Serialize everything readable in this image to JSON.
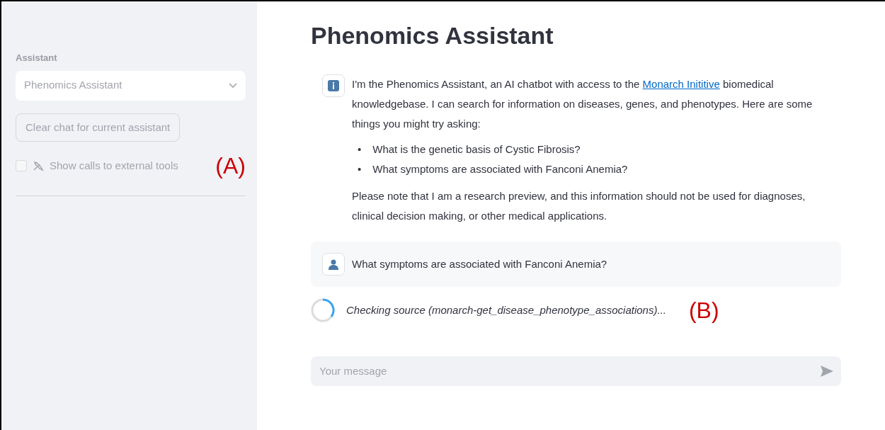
{
  "sidebar": {
    "select_label": "Assistant",
    "select": {
      "value": "Phenomics Assistant",
      "disabled": true
    },
    "clear_button": {
      "label": "Clear chat for current assistant",
      "disabled": true
    },
    "checkbox": {
      "label": "Show calls to external tools",
      "checked": false,
      "disabled": true
    },
    "annotation": "(A)"
  },
  "main": {
    "title": "Phenomics Assistant",
    "messages": [
      {
        "kind": "assistant",
        "intro_before": "I'm the Phenomics Assistant, an AI chatbot with access to the ",
        "link": "Monarch Inititive",
        "intro_after": " biomedical knowledgebase. I can search for information on diseases, genes, and phenotypes. Here are some things you might try asking:",
        "bullets": [
          {
            "marker": "•",
            "text": "What is the genetic basis of Cystic Fibrosis?"
          },
          {
            "marker": "•",
            "text": "What symptoms are associated with Fanconi Anemia?"
          }
        ],
        "note": "Please note that I am a research preview, and this information should not be used for diagnoses, clinical decision making, or other medical applications."
      },
      {
        "kind": "user",
        "text": "What symptoms are associated with Fanconi Anemia?"
      }
    ],
    "status": {
      "text": "Checking source (monarch-get_disease_phenotype_associations)...",
      "annotation": "(B)"
    },
    "input": {
      "placeholder": "Your message"
    }
  }
}
